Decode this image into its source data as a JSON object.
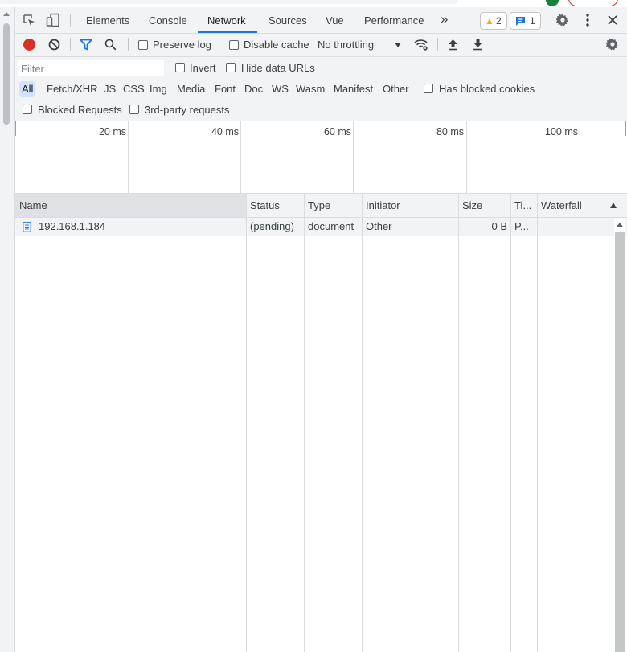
{
  "tabs": {
    "elements": "Elements",
    "console": "Console",
    "network": "Network",
    "sources": "Sources",
    "vue": "Vue",
    "performance": "Performance",
    "more": "»"
  },
  "badges": {
    "warnings": "2",
    "messages": "1"
  },
  "toolbar": {
    "preserve_log": "Preserve log",
    "disable_cache": "Disable cache",
    "throttling": "No throttling"
  },
  "filter": {
    "placeholder": "Filter",
    "invert": "Invert",
    "hide_data_urls": "Hide data URLs",
    "types": [
      "All",
      "Fetch/XHR",
      "JS",
      "CSS",
      "Img",
      "Media",
      "Font",
      "Doc",
      "WS",
      "Wasm",
      "Manifest",
      "Other"
    ],
    "has_blocked_cookies": "Has blocked cookies",
    "blocked_requests": "Blocked Requests",
    "third_party": "3rd-party requests"
  },
  "overview": {
    "ticks": [
      "20 ms",
      "40 ms",
      "60 ms",
      "80 ms",
      "100 ms"
    ]
  },
  "table": {
    "headers": {
      "name": "Name",
      "status": "Status",
      "type": "Type",
      "initiator": "Initiator",
      "size": "Size",
      "time": "Ti...",
      "waterfall": "Waterfall"
    },
    "rows": [
      {
        "name": "192.168.1.184",
        "status": "(pending)",
        "type": "document",
        "initiator": "Other",
        "size": "0 B",
        "time": "P..."
      }
    ]
  },
  "colors": {
    "accent": "#1a73e8",
    "record": "#d93025",
    "warning": "#f9ab00"
  }
}
